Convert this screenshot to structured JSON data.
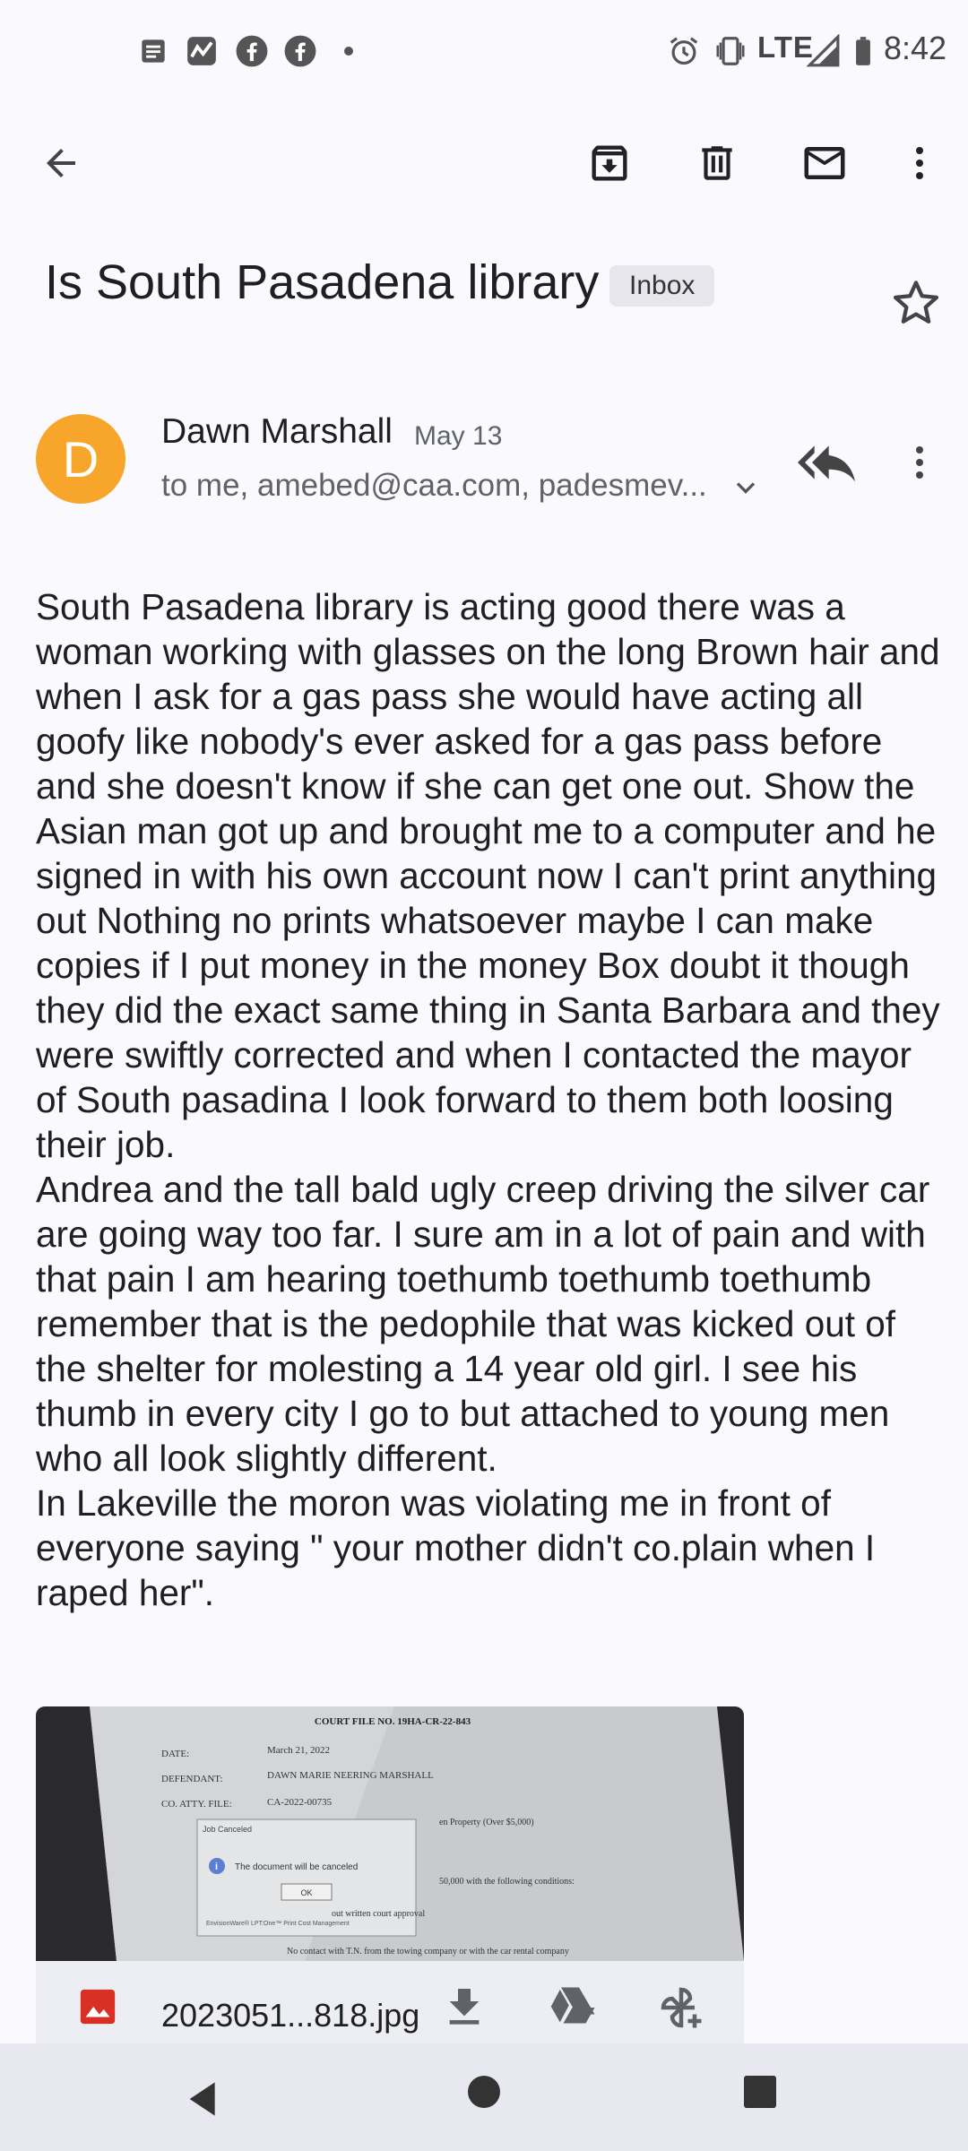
{
  "status_bar": {
    "network": "LTE",
    "time": "8:42",
    "icons": [
      "notes-icon",
      "activity-icon",
      "facebook-icon",
      "facebook-icon",
      "more-dot-icon",
      "alarm-icon",
      "vibrate-icon",
      "signal-icon",
      "battery-icon"
    ]
  },
  "toolbar": {
    "icons": [
      "back-arrow-icon",
      "archive-icon",
      "delete-icon",
      "mark-unread-icon",
      "more-vert-icon"
    ]
  },
  "email": {
    "subject": "Is South Pasadena library",
    "label": "Inbox",
    "sender": {
      "initial": "D",
      "name": "Dawn Marshall",
      "date": "May 13",
      "recipients": "to me, amebed@caa.com, padesmev...",
      "avatar_color": "#f8a52b"
    },
    "body": [
      "South Pasadena library is acting good there was a woman working with glasses on the long Brown hair and when I ask for a gas pass she would have acting all goofy like nobody's ever asked for a gas pass before and she doesn't know if she can get one out. Show the Asian man got up and brought me to a computer and he signed in with his own account now I can't print anything out Nothing no prints whatsoever maybe I can make copies if I put money in the money Box doubt it though they did the exact same thing in Santa Barbara and they were swiftly corrected and when I contacted the mayor of South pasadina I look forward to them both loosing their job.",
      "Andrea and the tall bald ugly creep driving the silver car are going way too far. I sure am in a lot of pain and with that pain I am hearing toethumb toethumb toethumb remember that is the pedophile that was kicked out of the shelter for molesting a 14 year old girl. I see his thumb in every city I go to but attached to young men who all look slightly different.",
      "In Lakeville the moron was violating me in front of everyone saying \" your mother didn't co.plain when I raped her\"."
    ],
    "attachment": {
      "filename": "2023051...818.jpg",
      "doc_title": "COURT FILE NO. 19HA-CR-22-843",
      "doc_fields": [
        {
          "label": "DATE:",
          "value": "March 21, 2022"
        },
        {
          "label": "DEFENDANT:",
          "value": "DAWN MARIE NEERING MARSHALL"
        },
        {
          "label": "CO. ATTY. FILE:",
          "value": "CA-2022-00735"
        }
      ],
      "dialog_title": "Job Canceled",
      "dialog_message": "The document will be canceled",
      "dialog_ok": "OK",
      "dialog_footer": "EnvisionWare® LPT:One™ Print Cost Management",
      "doc_bullet": "No contact with T.N. from the towing company or with the car rental company"
    }
  }
}
